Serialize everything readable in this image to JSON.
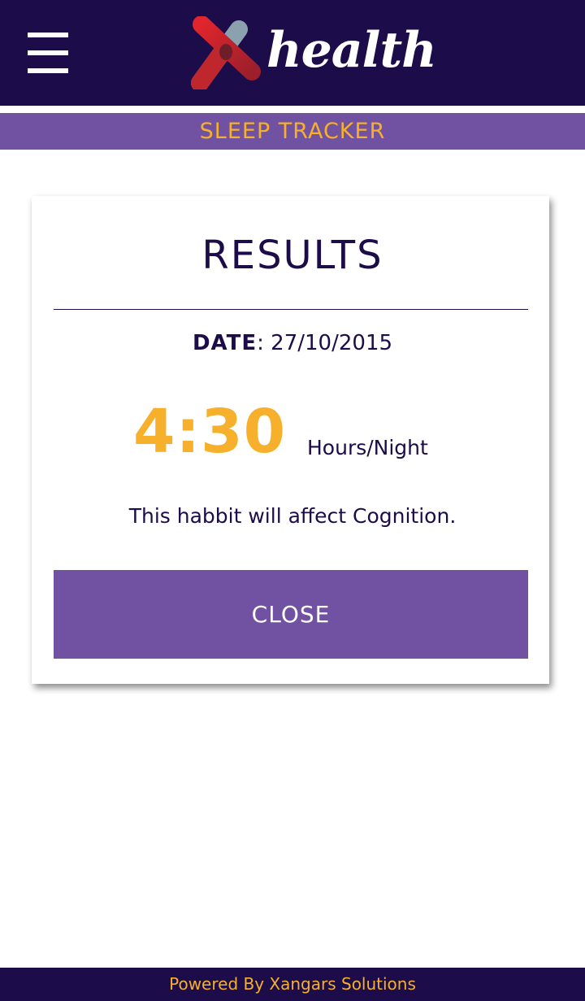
{
  "header": {
    "logo_text": "health",
    "logo_icon": "x-mark-logo-icon",
    "menu_icon": "hamburger-menu-icon"
  },
  "section_title": "SLEEP TRACKER",
  "results": {
    "title": "RESULTS",
    "date_label": "DATE",
    "date_separator": ":",
    "date_value": "27/10/2015",
    "value": "4:30",
    "unit": "Hours/Night",
    "message": "This habbit will affect Cognition.",
    "close_label": "CLOSE"
  },
  "footer": {
    "text": "Powered By Xangars Solutions"
  },
  "colors": {
    "navy": "#1c0c4a",
    "purple": "#7152a2",
    "accent_orange": "#f6b02b",
    "logo_red": "#c0272d",
    "logo_grey": "#8ba2ae"
  }
}
